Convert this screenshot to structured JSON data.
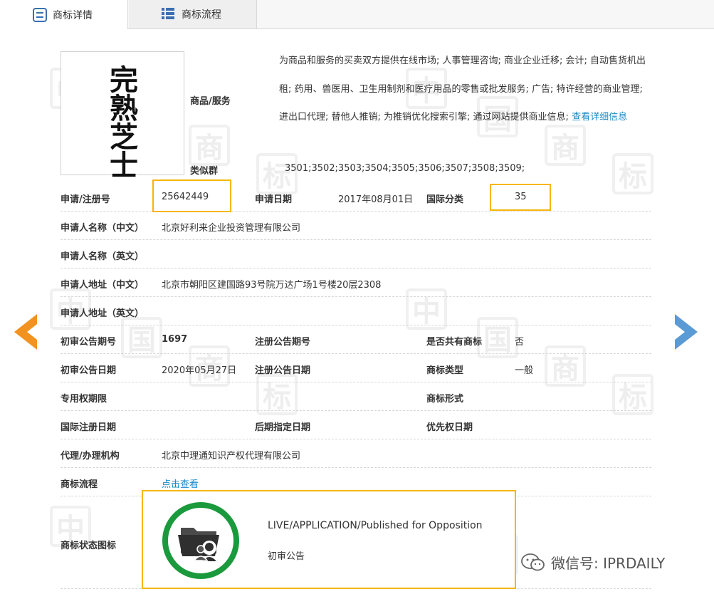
{
  "tabs": [
    {
      "label": "商标详情",
      "icon": "detail-icon"
    },
    {
      "label": "商标流程",
      "icon": "list-icon"
    }
  ],
  "watermark_chars": [
    "中",
    "国",
    "商",
    "标"
  ],
  "trademark_image_text": "完熟芝士",
  "goods": {
    "label": "商品/服务",
    "text": "为商品和服务的买卖双方提供在线市场; 人事管理咨询; 商业企业迁移; 会计; 自动售货机出租; 药用、兽医用、卫生用制剂和医疗用品的零售或批发服务; 广告; 特许经营的商业管理; 进出口代理; 替他人推销; 为推销优化搜索引擎; 通过网站提供商业信息; ",
    "more_link": "查看详细信息"
  },
  "similar_group": {
    "label": "类似群",
    "value": "3501;3502;3503;3504;3505;3506;3507;3508;3509;"
  },
  "rows": {
    "reg_no_label": "申请/注册号",
    "reg_no": "25642449",
    "apply_date_label": "申请日期",
    "apply_date": "2017年08月01日",
    "intl_class_label": "国际分类",
    "intl_class": "35",
    "applicant_cn_label": "申请人名称（中文）",
    "applicant_cn": "北京好利来企业投资管理有限公司",
    "applicant_en_label": "申请人名称（英文）",
    "applicant_en": "",
    "address_cn_label": "申请人地址（中文）",
    "address_cn": "北京市朝阳区建国路93号院万达广场1号楼20层2308",
    "address_en_label": "申请人地址（英文）",
    "address_en": "",
    "prelim_no_label": "初审公告期号",
    "prelim_no": "1697",
    "reg_pub_no_label": "注册公告期号",
    "reg_pub_no": "",
    "shared_label": "是否共有商标",
    "shared": "否",
    "prelim_date_label": "初审公告日期",
    "prelim_date": "2020年05月27日",
    "reg_pub_date_label": "注册公告日期",
    "reg_pub_date": "",
    "tm_type_label": "商标类型",
    "tm_type": "一般",
    "excl_label": "专用权期限",
    "excl": "",
    "tm_form_label": "商标形式",
    "tm_form": "",
    "intl_reg_date_label": "国际注册日期",
    "intl_reg_date": "",
    "later_date_label": "后期指定日期",
    "later_date": "",
    "priority_date_label": "优先权日期",
    "priority_date": "",
    "agent_label": "代理/办理机构",
    "agent": "北京中理通知识产权代理有限公司",
    "flow_label": "商标流程",
    "flow_link": "点击查看",
    "status_label": "商标状态图标"
  },
  "status": {
    "en": "LIVE/APPLICATION/Published for Opposition",
    "cn": "初审公告",
    "ring_color": "#1a9a3c"
  },
  "footer": {
    "wechat": "微信号: IPRDAILY"
  },
  "colors": {
    "highlight": "#f5b60a",
    "link": "#1a8ac6",
    "arrow_left": "#f29220",
    "arrow_right": "#5a9bd5"
  }
}
